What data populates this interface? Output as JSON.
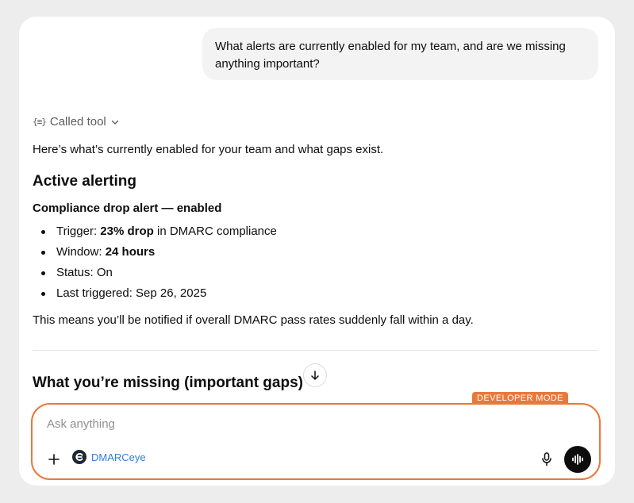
{
  "conversation": {
    "user_message": "What alerts are currently enabled for my team, and are we missing anything important?",
    "tool_label": "Called tool",
    "tool_icon": "{≡}",
    "intro": "Here’s what’s currently enabled for your team and what gaps exist.",
    "section_active": "Active alerting",
    "alert_title": "Compliance drop alert — enabled",
    "bullets": [
      {
        "label": "Trigger: ",
        "bold": "23% drop",
        "rest": " in DMARC compliance"
      },
      {
        "label": "Window: ",
        "bold": "24 hours",
        "rest": ""
      },
      {
        "label": "Status: On",
        "bold": "",
        "rest": ""
      },
      {
        "label": "Last triggered: Sep 26, 2025",
        "bold": "",
        "rest": ""
      }
    ],
    "summary": "This means you’ll be notified if overall DMARC pass rates suddenly fall within a day.",
    "section_missing": "What you’re missing (important gaps)"
  },
  "composer": {
    "badge": "DEVELOPER MODE",
    "placeholder": "Ask anything",
    "connector_label": "DMARCeye"
  },
  "icons": {
    "tool": "braces-list-icon",
    "chevron": "chevron-down-icon",
    "scroll": "arrow-down-icon",
    "plus": "plus-icon",
    "connector": "dmarceye-logo-icon",
    "mic": "microphone-icon",
    "voice": "voice-waveform-icon"
  },
  "colors": {
    "accent": "#e8793a",
    "link": "#2f7de1",
    "bubble": "#f3f3f3"
  }
}
